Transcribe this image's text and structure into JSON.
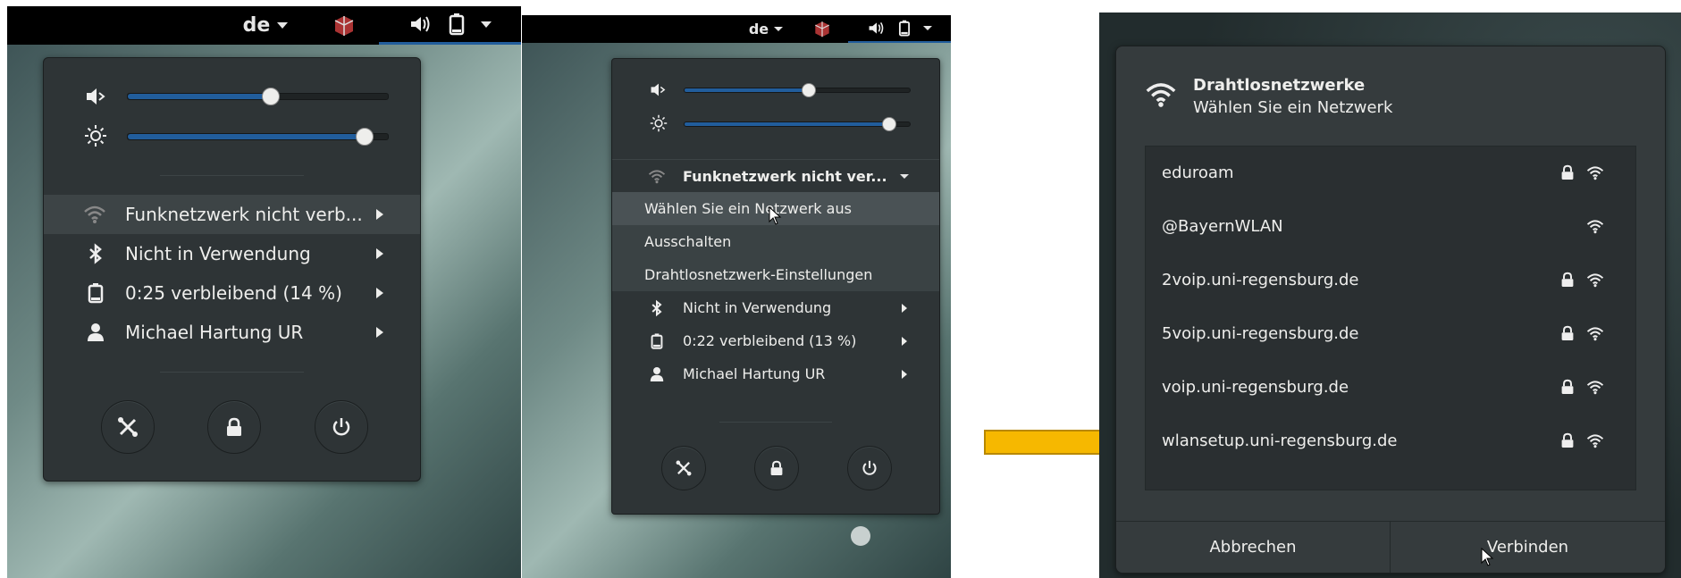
{
  "panel1": {
    "topbar": {
      "lang": "de"
    },
    "menu": {
      "wifi_label": "Funknetzwerk nicht verb...",
      "bluetooth_label": "Nicht in Verwendung",
      "battery_label": "0:25 verbleibend (14 %)",
      "user_label": "Michael Hartung UR"
    },
    "sliders": {
      "volume_level": 0.55,
      "brightness_level": 0.91
    }
  },
  "panel2": {
    "topbar": {
      "lang": "de"
    },
    "menu": {
      "wifi_label": "Funknetzwerk nicht ver...",
      "submenu": [
        "Wählen Sie ein Netzwerk aus",
        "Ausschalten",
        "Drahtlosnetzwerk-Einstellungen"
      ],
      "bluetooth_label": "Nicht in Verwendung",
      "battery_label": "0:22 verbleibend (13 %)",
      "user_label": "Michael Hartung UR"
    },
    "sliders": {
      "volume_level": 0.55,
      "brightness_level": 0.91
    }
  },
  "dialog": {
    "title": "Drahtlosnetzwerke",
    "subtitle": "Wählen Sie ein Netzwerk",
    "networks": [
      {
        "name": "eduroam",
        "secured": true
      },
      {
        "name": "@BayernWLAN",
        "secured": false
      },
      {
        "name": "2voip.uni-regensburg.de",
        "secured": true
      },
      {
        "name": "5voip.uni-regensburg.de",
        "secured": true
      },
      {
        "name": "voip.uni-regensburg.de",
        "secured": true
      },
      {
        "name": "wlansetup.uni-regensburg.de",
        "secured": true
      }
    ],
    "cancel_label": "Abbrechen",
    "connect_label": "Verbinden"
  },
  "colors": {
    "arrow": "#f6b800",
    "accent": "#215d9c",
    "menu_bg": "#2e3436",
    "topbar": "#000000"
  }
}
